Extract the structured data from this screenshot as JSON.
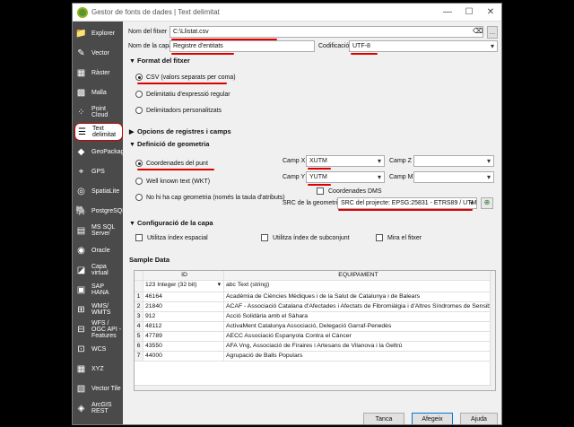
{
  "window": {
    "title": "Gestor de fonts de dades | Text delimitat",
    "controls": {
      "minimize": "—",
      "maximize": "☐",
      "close": "✕"
    }
  },
  "sidebar": {
    "items": [
      {
        "label": "Explorer",
        "icon": "folder-icon"
      },
      {
        "label": "Vector",
        "icon": "vector-icon"
      },
      {
        "label": "Ràster",
        "icon": "raster-icon"
      },
      {
        "label": "Malla",
        "icon": "mesh-icon"
      },
      {
        "label": "Point Cloud",
        "icon": "point-cloud-icon"
      },
      {
        "label": "Text delimitat",
        "icon": "delimited-text-icon"
      },
      {
        "label": "GeoPackage",
        "icon": "geopackage-icon"
      },
      {
        "label": "GPS",
        "icon": "gps-icon"
      },
      {
        "label": "SpatiaLite",
        "icon": "spatialite-icon"
      },
      {
        "label": "PostgreSQL",
        "icon": "postgresql-icon"
      },
      {
        "label": "MS SQL Server",
        "icon": "mssql-icon"
      },
      {
        "label": "Oracle",
        "icon": "oracle-icon"
      },
      {
        "label": "Capa virtual",
        "icon": "virtual-layer-icon"
      },
      {
        "label": "SAP HANA",
        "icon": "sap-hana-icon"
      },
      {
        "label": "WMS/ WMTS",
        "icon": "wms-icon"
      },
      {
        "label": "WFS / OGC API - Features",
        "icon": "wfs-icon"
      },
      {
        "label": "WCS",
        "icon": "wcs-icon"
      },
      {
        "label": "XYZ",
        "icon": "xyz-icon"
      },
      {
        "label": "Vector Tile",
        "icon": "vector-tile-icon"
      },
      {
        "label": "ArcGIS REST",
        "icon": "arcgis-rest-icon"
      }
    ]
  },
  "file": {
    "label": "Nom del fitxer",
    "value": "C:\\Llistat.csv",
    "browse_label": "…"
  },
  "layer": {
    "label": "Nom de la capa",
    "value": "Registre d'entitats",
    "encoding_label": "Codificació",
    "encoding_value": "UTF-8"
  },
  "format": {
    "title": "Format del fitxer",
    "options": [
      "CSV (valors separats per coma)",
      "Delimitatiu d'expressió regular",
      "Delimitadors personalitzats"
    ],
    "selected": 0
  },
  "record_options": {
    "title": "Opcions de registres i camps"
  },
  "geometry": {
    "title": "Definició de geometria",
    "options": [
      "Coordenades del punt",
      "Well known text (WKT)",
      "No hi ha cap geometria (només la taula d'atributs)"
    ],
    "selected": 0,
    "x_label": "Camp X",
    "x_value": "XUTM",
    "y_label": "Camp Y",
    "y_value": "YUTM",
    "z_label": "Camp Z",
    "z_value": "",
    "m_label": "Camp M",
    "m_value": "",
    "dms_label": "Coordenades DMS",
    "crs_label": "SRC de la geometria",
    "crs_value": "SRC del projecte: EPSG:25831 - ETRS89 / UTM zon"
  },
  "layer_settings": {
    "title": "Configuració de la capa",
    "options": [
      "Utilitza índex espacial",
      "Utilitza índex de subconjunt",
      "Mira el fitxer"
    ]
  },
  "sample": {
    "title": "Sample Data",
    "columns": [
      "ID",
      "EQUIPAMENT"
    ],
    "types": [
      "123 Integer (32 bit)",
      "abc Text (string)"
    ],
    "rows": [
      [
        "1",
        "46164",
        "Acadèmia de Ciències Mèdiques i de la Salut de Catalunya i de Balears"
      ],
      [
        "2",
        "21840",
        "ACAF - Associació Catalana d'Afectades i Afectats de Fibromiàlgia i d'Altres Síndromes de Sensib"
      ],
      [
        "3",
        "912",
        "Acció Solidària amb el Sàhara"
      ],
      [
        "4",
        "48112",
        "ActivaMent Catalunya Associació, Delegació Garraf-Penedès"
      ],
      [
        "5",
        "47789",
        "AECC Associació Espanyola Contra el Càncer"
      ],
      [
        "6",
        "43550",
        "AFA Vng, Associació de Firaires i Artesans de Vilanova i la Geltrú"
      ],
      [
        "7",
        "44000",
        "Agrupació de Balls Populars"
      ]
    ]
  },
  "buttons": {
    "close": "Tanca",
    "add": "Afegeix",
    "help": "Ajuda"
  },
  "colors": {
    "annotation": "#d00000",
    "sidebar_bg": "#4a4a4a",
    "qgis_green": "#589632"
  }
}
